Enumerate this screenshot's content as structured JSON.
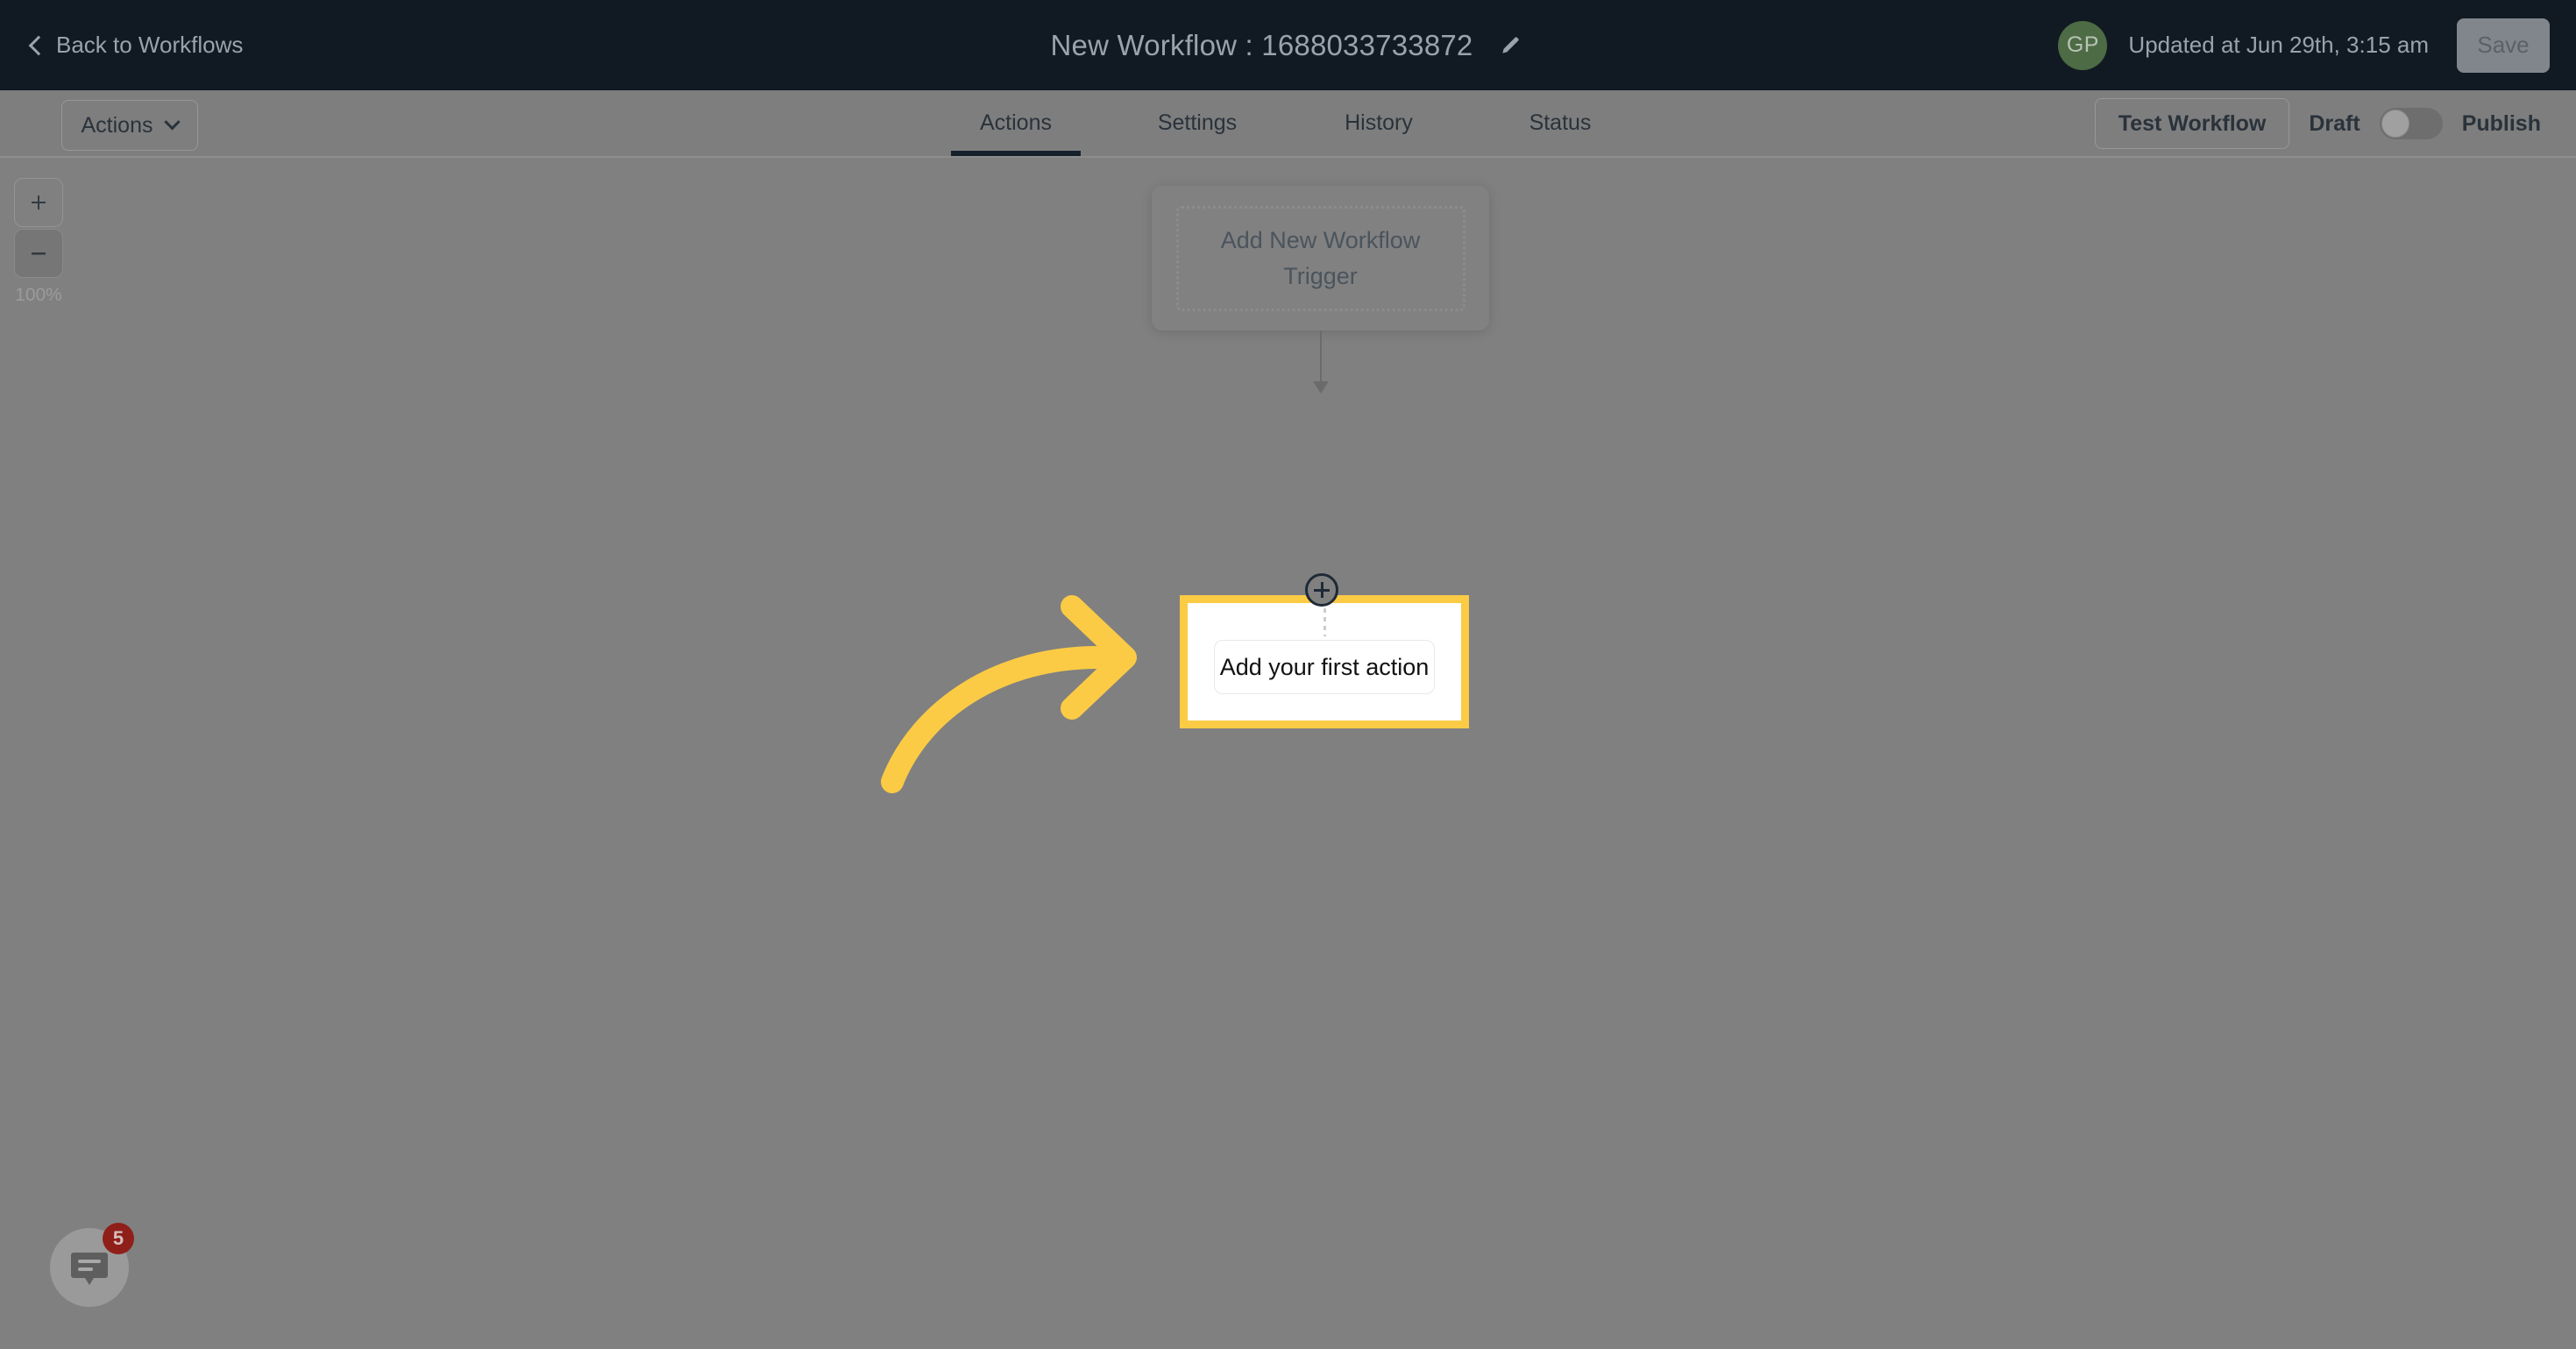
{
  "header": {
    "back_label": "Back to Workflows",
    "back_icon": "chevron-left-icon",
    "title": "New Workflow : 1688033733872",
    "edit_icon": "pencil-icon",
    "avatar_initials": "GP",
    "avatar_color": "#4D6B44",
    "updated_text": "Updated at Jun 29th, 3:15 am",
    "save_label": "Save",
    "background_color": "#111A23"
  },
  "toolbar": {
    "actions_dropdown_label": "Actions",
    "actions_dropdown_icon": "chevron-down-icon",
    "tabs": [
      {
        "label": "Actions",
        "active": true
      },
      {
        "label": "Settings",
        "active": false
      },
      {
        "label": "History",
        "active": false
      },
      {
        "label": "Status",
        "active": false
      }
    ],
    "test_workflow_label": "Test Workflow",
    "draft_label": "Draft",
    "publish_label": "Publish",
    "toggle_state": "off"
  },
  "zoom_controls": {
    "zoom_in_icon": "plus-icon",
    "zoom_out_icon": "minus-icon",
    "zoom_level": "100%"
  },
  "canvas": {
    "trigger_node_label": "Add New Workflow Trigger",
    "add_step_icon": "plus-circle-icon",
    "action_node_label": "Add your first action",
    "highlight_color": "#FBCB45",
    "annotation_arrow_icon": "curved-arrow-right-icon",
    "annotation_arrow_color": "#FBCB45"
  },
  "chat_widget": {
    "icon": "chat-bubble-icon",
    "badge_count": "5",
    "badge_color": "#8F1F19"
  },
  "overlay": {
    "dim_color": "#808080"
  }
}
